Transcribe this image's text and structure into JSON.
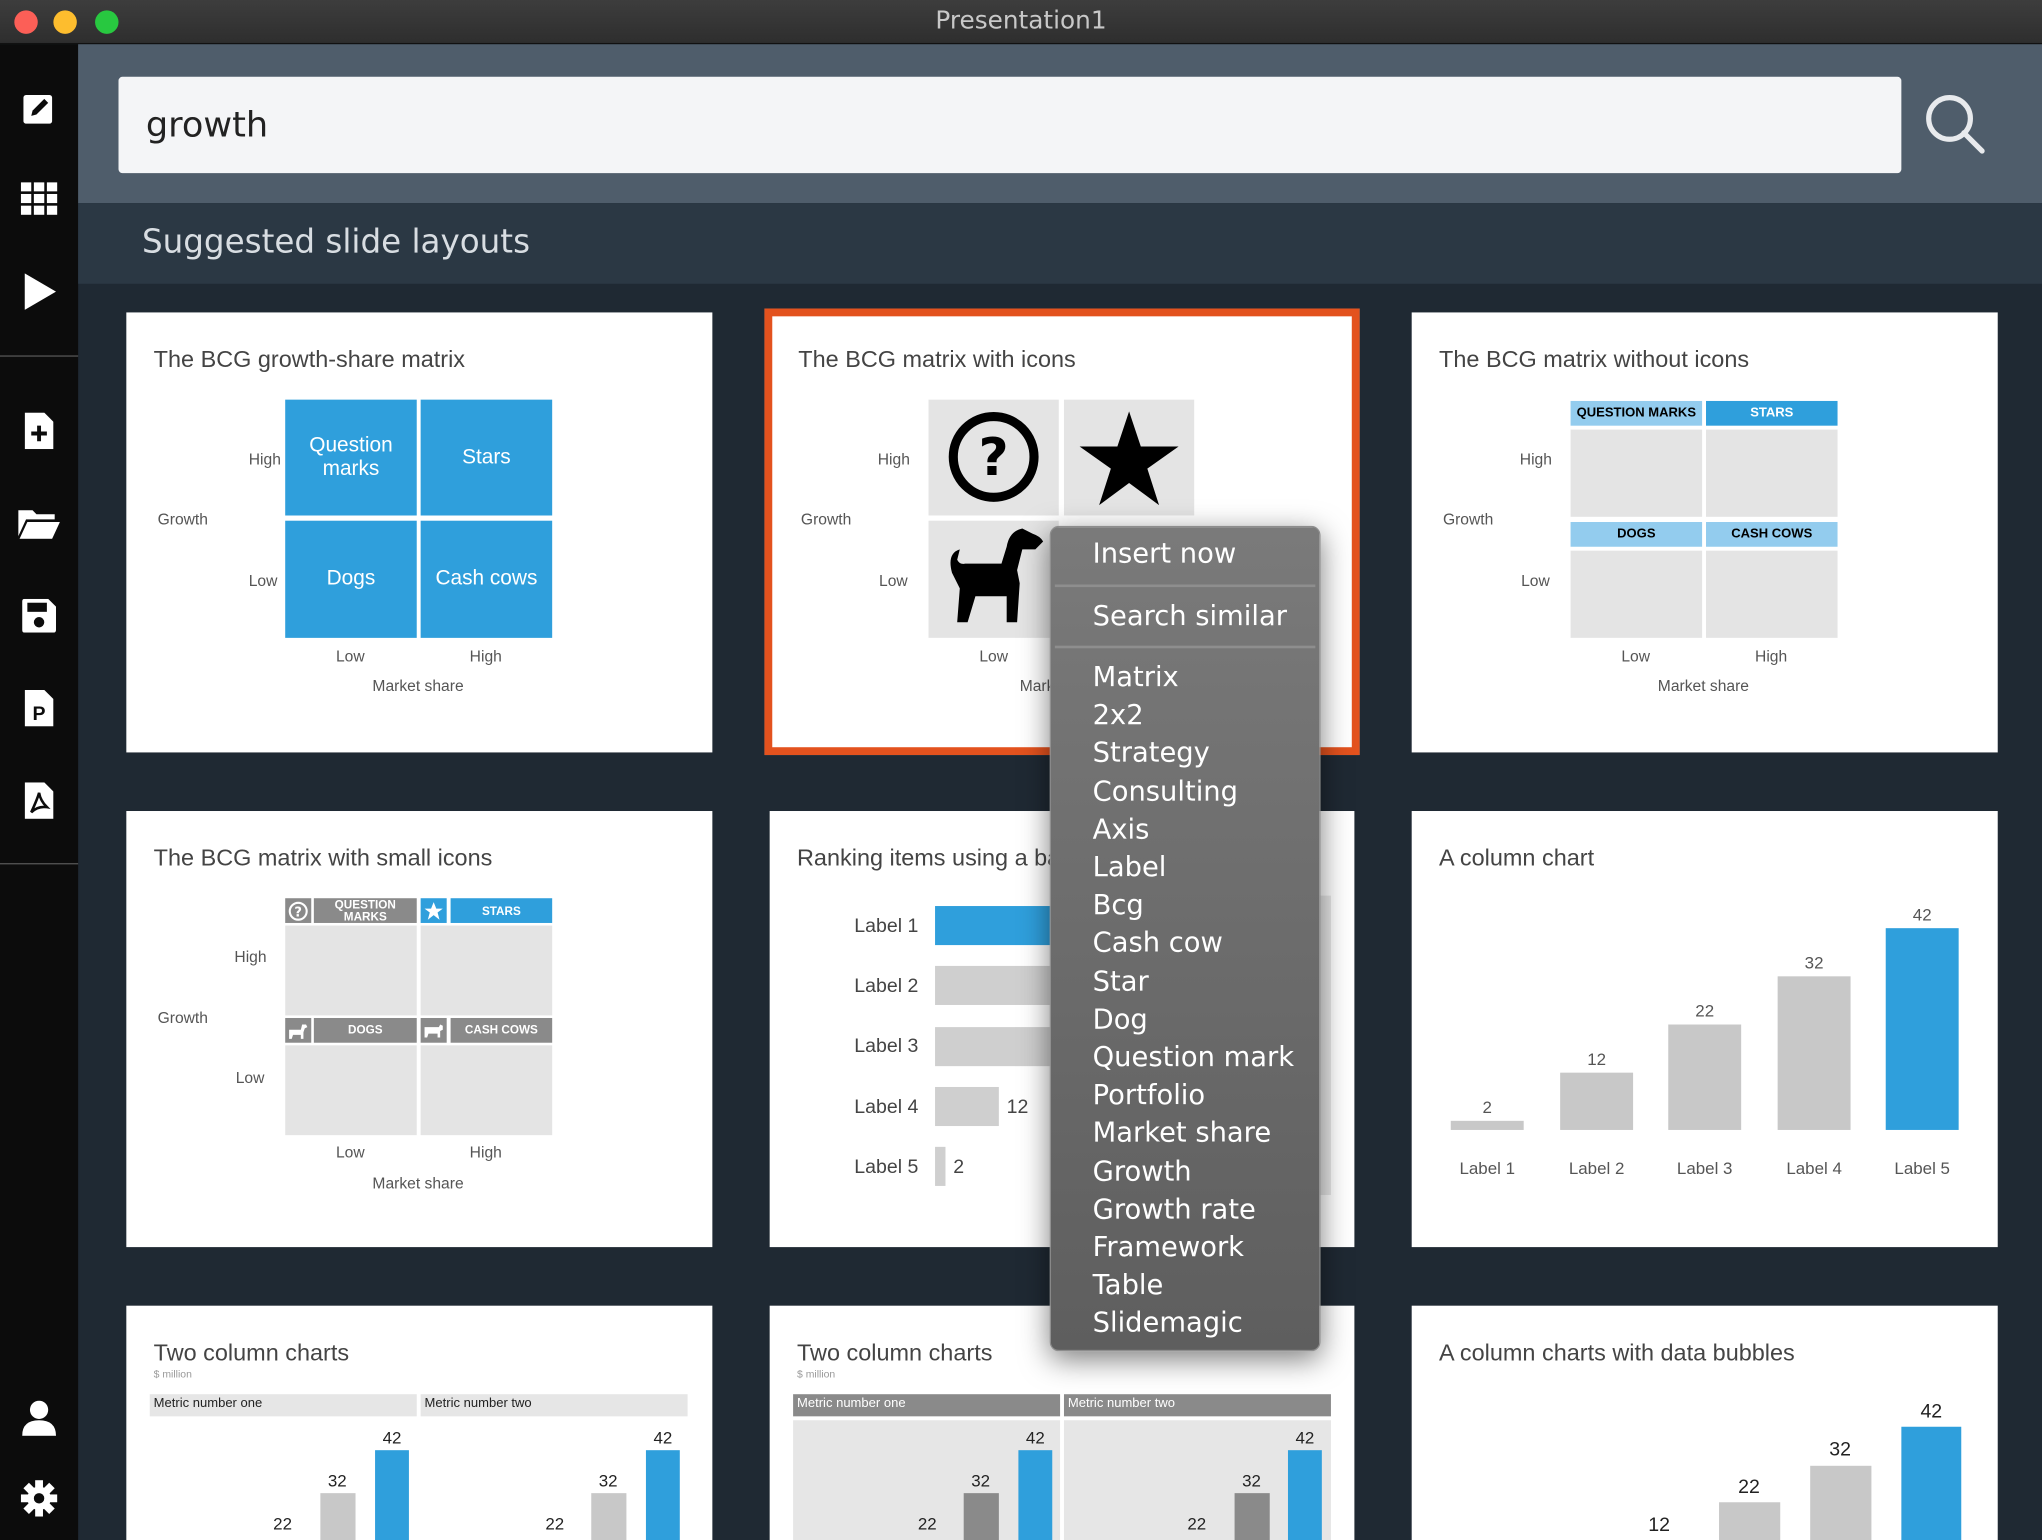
{
  "window": {
    "title": "Presentation1"
  },
  "sidebar": {
    "items": [
      "edit-icon",
      "grid-icon",
      "play-icon",
      "new-slide-icon",
      "open-folder-icon",
      "save-icon",
      "export-pptx-icon",
      "export-pdf-icon",
      "user-icon",
      "settings-icon"
    ]
  },
  "search": {
    "value": "growth"
  },
  "section_title": "Suggested slide layouts",
  "common": {
    "growth": "Growth",
    "high": "High",
    "low": "Low",
    "market_share": "Market share"
  },
  "cards": [
    {
      "title": "The BCG growth-share matrix",
      "cells": [
        "Question marks",
        "Stars",
        "Dogs",
        "Cash cows"
      ]
    },
    {
      "title": "The BCG matrix with icons",
      "cut_label": "Mark"
    },
    {
      "title": "The BCG matrix without icons",
      "labels": [
        "QUESTION MARKS",
        "STARS",
        "DOGS",
        "CASH COWS"
      ]
    },
    {
      "title": "The BCG matrix with small icons",
      "labels": [
        "QUESTION MARKS",
        "STARS",
        "DOGS",
        "CASH COWS"
      ]
    },
    {
      "title": "Ranking items using a ba",
      "rows": [
        {
          "label": "Label 1",
          "value": ""
        },
        {
          "label": "Label 2",
          "value": ""
        },
        {
          "label": "Label 3",
          "value": ""
        },
        {
          "label": "Label 4",
          "value": "12"
        },
        {
          "label": "Label 5",
          "value": "2"
        }
      ]
    },
    {
      "title": "A column chart",
      "categories": [
        "Label 1",
        "Label 2",
        "Label 3",
        "Label 4",
        "Label 5"
      ],
      "values": [
        "2",
        "12",
        "22",
        "32",
        "42"
      ]
    },
    {
      "title": "Two column charts",
      "subtitle": "$ million",
      "metrics": [
        "Metric number one",
        "Metric number two"
      ],
      "values": [
        "22",
        "32",
        "42"
      ]
    },
    {
      "title": "Two column charts",
      "subtitle": "$ million",
      "metrics": [
        "Metric number one",
        "Metric number two"
      ],
      "values": [
        "22",
        "32",
        "42"
      ]
    },
    {
      "title": "A column charts with data bubbles",
      "values": [
        "12",
        "22",
        "32",
        "42"
      ]
    }
  ],
  "context_menu": {
    "actions": [
      "Insert now",
      "Search similar"
    ],
    "tags": [
      "Matrix",
      "2x2",
      "Strategy",
      "Consulting",
      "Axis",
      "Label",
      "Bcg",
      "Cash cow",
      "Star",
      "Dog",
      "Question mark",
      "Portfolio",
      "Market share",
      "Growth",
      "Growth rate",
      "Framework",
      "Table",
      "Slidemagic"
    ]
  },
  "colors": {
    "accent": "#2f9fdc",
    "selection": "#e3521e",
    "sidebar": "#0c0c0c",
    "background": "#1f2933"
  }
}
